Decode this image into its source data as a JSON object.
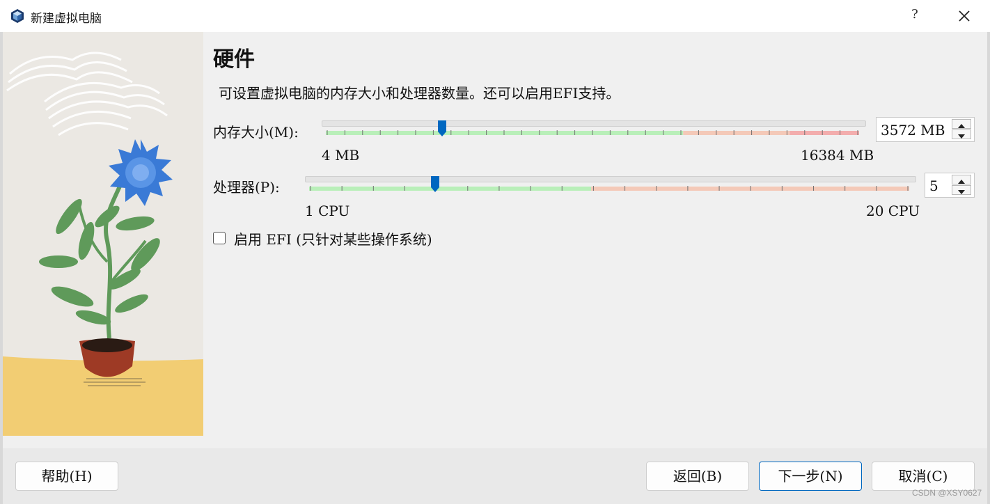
{
  "window": {
    "title": "新建虚拟电脑",
    "help_glyph": "?",
    "close_glyph": "✕"
  },
  "page": {
    "heading": "硬件",
    "description": "可设置虚拟电脑的内存大小和处理器数量。还可以启用EFI支持。"
  },
  "memory": {
    "label": "内存大小(M):",
    "min_label": "4 MB",
    "max_label": "16384 MB",
    "value_text": "3572 MB",
    "value_mb": 3572,
    "min_mb": 4,
    "max_mb": 16384,
    "green_fraction": 0.67,
    "red_start_fraction": 0.87,
    "tick_count": 31
  },
  "processor": {
    "label": "处理器(P):",
    "min_label": "1 CPU",
    "max_label": "20 CPU",
    "value_text": "5",
    "value": 5,
    "min": 1,
    "max": 20,
    "green_fraction": 0.47
  },
  "efi": {
    "label": "启用 EFI (只针对某些操作系统)",
    "checked": false
  },
  "footer": {
    "help_button": "帮助(H)",
    "back_button": "返回(B)",
    "next_button": "下一步(N)",
    "cancel_button": "取消(C)",
    "watermark": "CSDN @XSY0627"
  },
  "colors": {
    "accent": "#0067c0",
    "slider_green": "#b9efb9",
    "slider_orange": "#f4c9b8",
    "slider_red": "#f3adad",
    "pot": "#9e3a25",
    "leaf": "#5f9a5a",
    "flower": "#3a7ad6",
    "ground": "#f2cd73"
  }
}
